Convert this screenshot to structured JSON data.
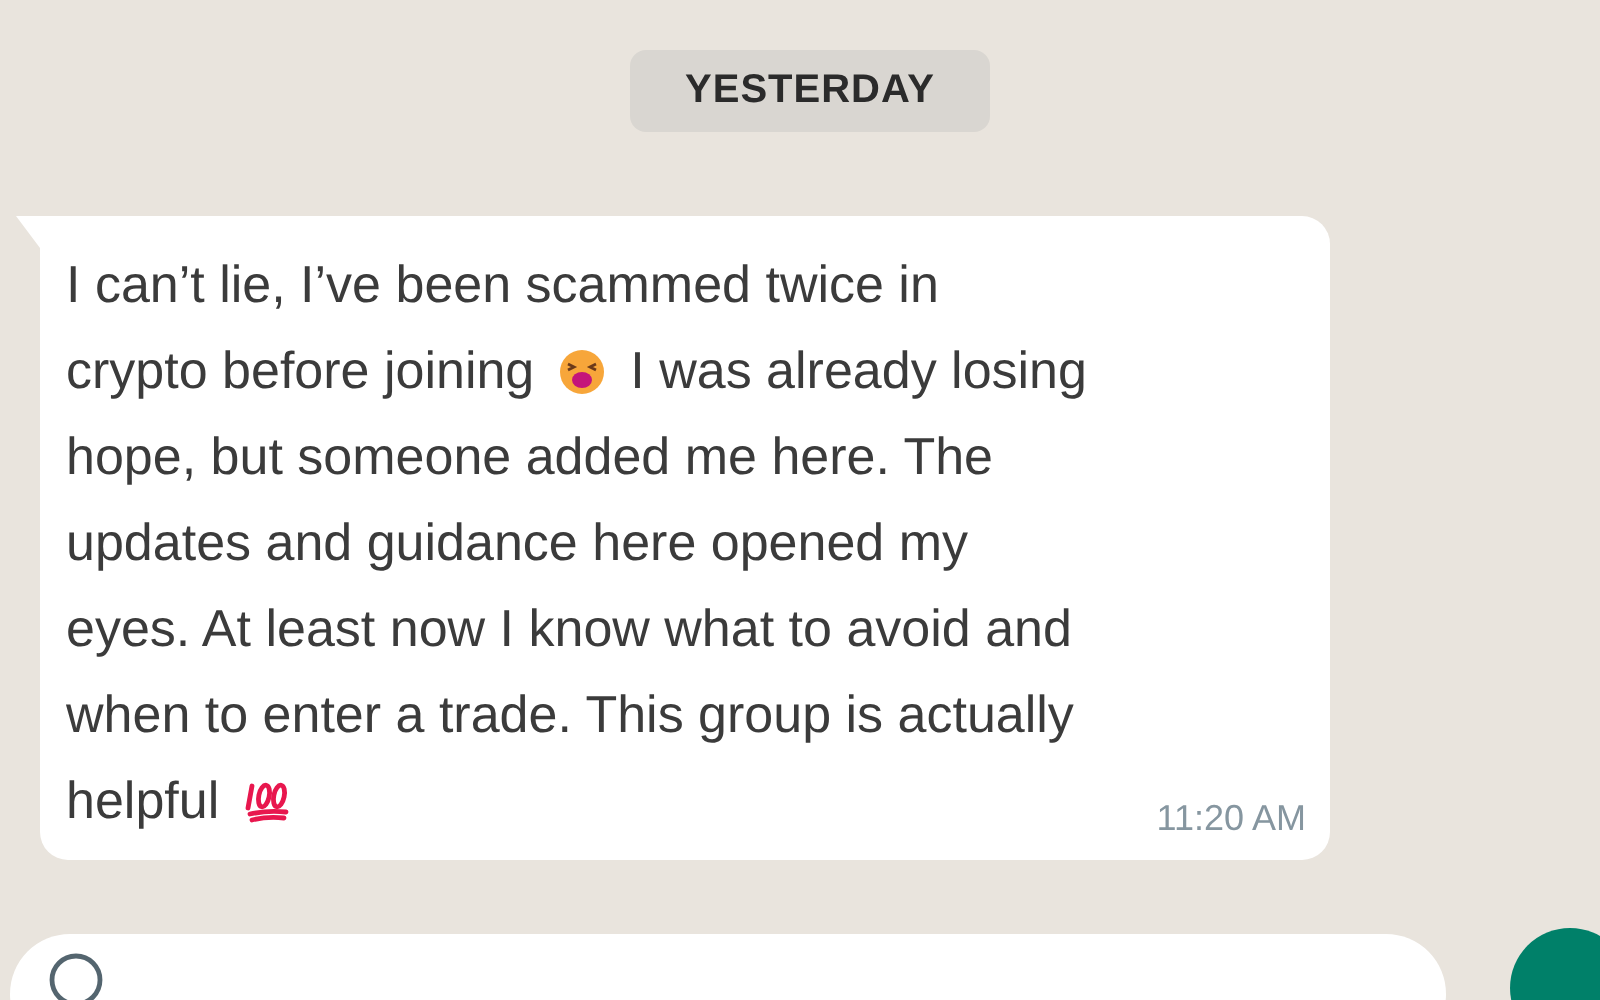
{
  "date_divider": "YESTERDAY",
  "message": {
    "lines": [
      [
        {
          "kind": "text",
          "text": "I can’t lie, I’ve been scammed twice in"
        }
      ],
      [
        {
          "kind": "text",
          "text": "crypto before joining"
        },
        {
          "kind": "tired-face"
        },
        {
          "kind": "text",
          "text": "I was already losing"
        }
      ],
      [
        {
          "kind": "text",
          "text": "hope, but someone added me here. The"
        }
      ],
      [
        {
          "kind": "text",
          "text": "updates and guidance here opened my"
        }
      ],
      [
        {
          "kind": "text",
          "text": "eyes. At least now I know what to avoid and"
        }
      ],
      [
        {
          "kind": "text",
          "text": "when to enter a trade. This group is actually"
        }
      ],
      [
        {
          "kind": "text",
          "text": "helpful"
        },
        {
          "kind": "hundred"
        }
      ]
    ],
    "time": "11:20 AM"
  }
}
